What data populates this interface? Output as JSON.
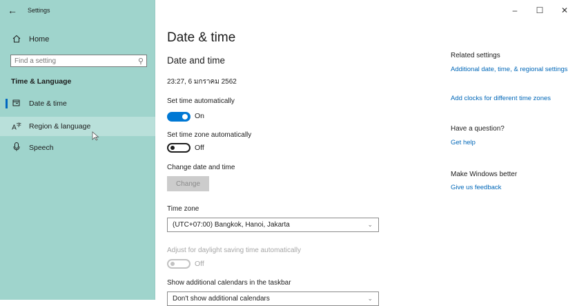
{
  "window": {
    "title": "Settings"
  },
  "sidebar": {
    "home_label": "Home",
    "search_placeholder": "Find a setting",
    "section_title": "Time & Language",
    "items": [
      {
        "label": "Date & time"
      },
      {
        "label": "Region & language"
      },
      {
        "label": "Speech"
      }
    ]
  },
  "main": {
    "page_title": "Date & time",
    "section_title": "Date and time",
    "current_datetime": "23:27, 6 มกราคม 2562",
    "set_time_auto": {
      "label": "Set time automatically",
      "state": "On"
    },
    "set_timezone_auto": {
      "label": "Set time zone automatically",
      "state": "Off"
    },
    "change_datetime": {
      "label": "Change date and time",
      "button": "Change"
    },
    "time_zone": {
      "label": "Time zone",
      "value": "(UTC+07:00) Bangkok, Hanoi, Jakarta"
    },
    "daylight_saving": {
      "label": "Adjust for daylight saving time automatically",
      "state": "Off"
    },
    "calendars": {
      "label": "Show additional calendars in the taskbar",
      "value": "Don't show additional calendars"
    }
  },
  "related": {
    "heading": "Related settings",
    "link1": "Additional date, time, & regional settings",
    "link2": "Add clocks for different time zones",
    "question_heading": "Have a question?",
    "help_link": "Get help",
    "better_heading": "Make Windows better",
    "feedback_link": "Give us feedback"
  },
  "colors": {
    "sidebar": "#9fd4cc",
    "accent": "#0078d4",
    "link": "#0067b8"
  }
}
